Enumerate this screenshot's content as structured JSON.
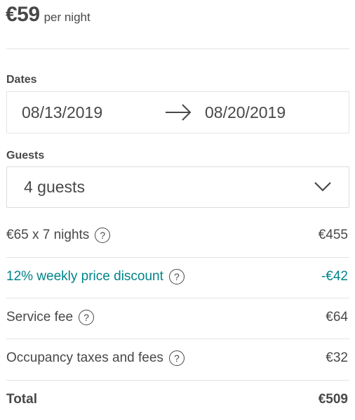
{
  "header": {
    "price": "€59",
    "per_night": "per night"
  },
  "dates": {
    "label": "Dates",
    "checkin": "08/13/2019",
    "checkout": "08/20/2019"
  },
  "guests": {
    "label": "Guests",
    "value": "4 guests"
  },
  "breakdown": [
    {
      "label": "€65 x 7 nights",
      "value": "€455",
      "help": "?"
    },
    {
      "label": "12% weekly price discount",
      "value": "-€42",
      "help": "?"
    },
    {
      "label": "Service fee",
      "value": "€64",
      "help": "?"
    },
    {
      "label": "Occupancy taxes and fees",
      "value": "€32",
      "help": "?"
    }
  ],
  "total": {
    "label": "Total",
    "value": "€509"
  },
  "colors": {
    "text": "#484848",
    "discount": "#008489",
    "border": "#e4e4e4"
  }
}
